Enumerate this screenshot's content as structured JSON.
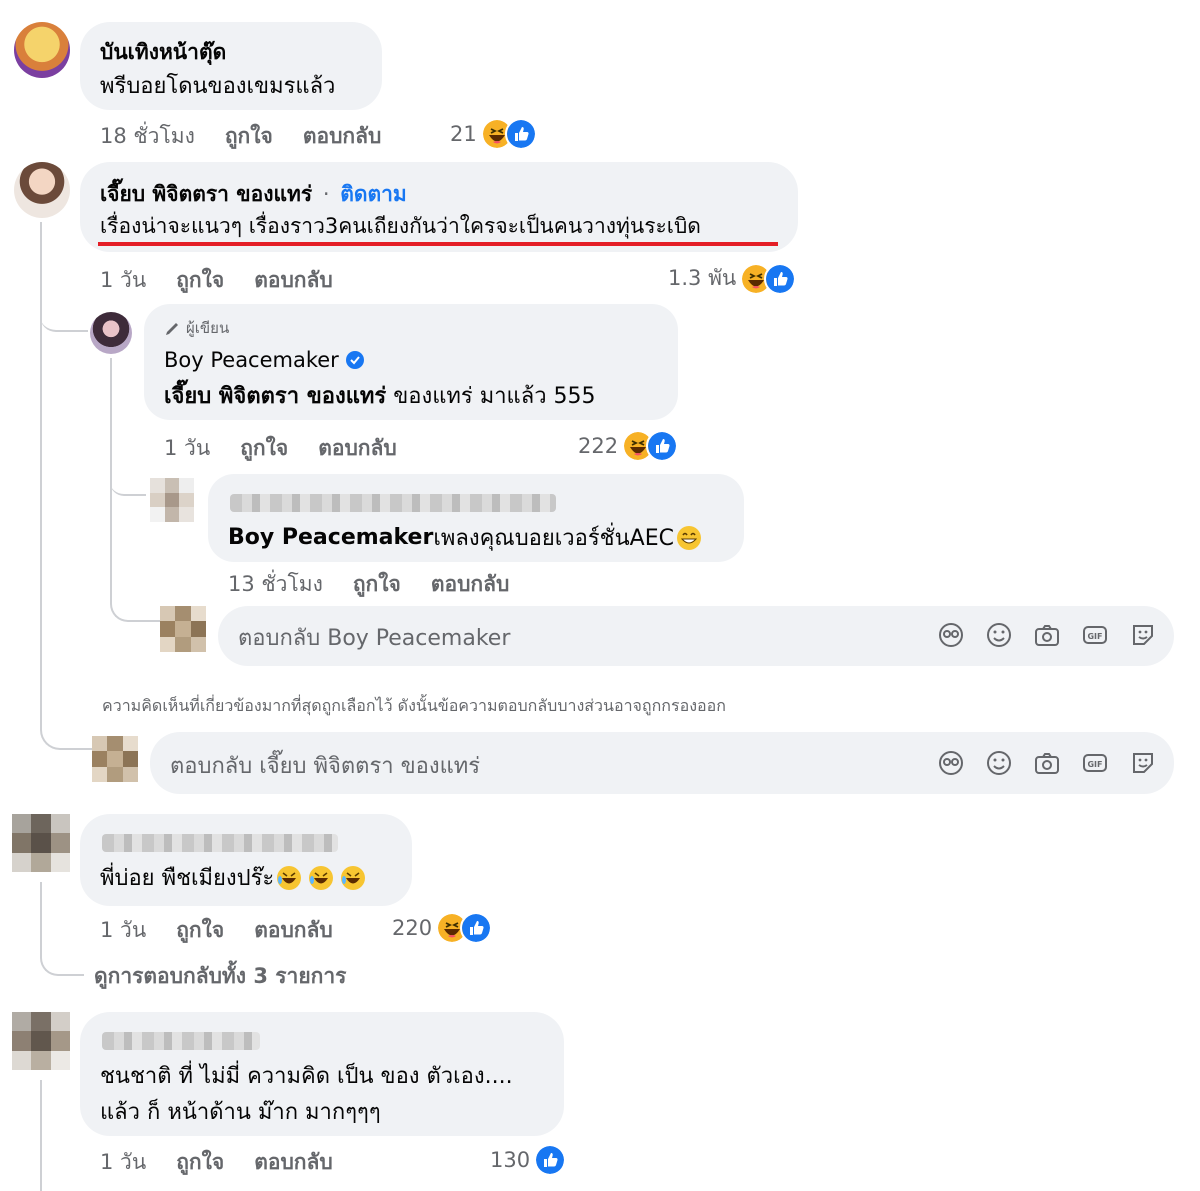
{
  "comments": [
    {
      "author": "บันเทิงหน้าตุ๊ด",
      "text": "พรีบอยโดนของเขมรแล้ว",
      "time": "18 ชั่วโมง",
      "like": "ถูกใจ",
      "reply": "ตอบกลับ",
      "reaction_count": "21"
    },
    {
      "author": "เจี๊ยบ พิจิตตรา ของแทร่",
      "separator": "·",
      "follow": "ติดตาม",
      "text": "เรื่องน่าจะแนวๆ เรื่องราว3คนเถียงกันว่าใครจะเป็นคนวางทุ่นระเบิด",
      "time": "1 วัน",
      "like": "ถูกใจ",
      "reply": "ตอบกลับ",
      "reaction_count": "1.3 พัน",
      "replies": [
        {
          "badge": "ผู้เขียน",
          "author": "Boy Peacemaker",
          "mention": "เจี๊ยบ พิจิตตรา ของแทร่",
          "text": " ของแทร่ มาแล้ว 555",
          "time": "1 วัน",
          "like": "ถูกใจ",
          "reply": "ตอบกลับ",
          "reaction_count": "222"
        },
        {
          "mention": "Boy Peacemaker",
          "text": " เพลงคุณบอยเวอร์ชั่นAEC",
          "time": "13 ชั่วโมง",
          "like": "ถูกใจ",
          "reply": "ตอบกลับ"
        }
      ],
      "reply_box_placeholder": "ตอบกลับ Boy Peacemaker",
      "filter_notice": "ความคิดเห็นที่เกี่ยวข้องมากที่สุดถูกเลือกไว้ ดังนั้นข้อความตอบกลับบางส่วนอาจถูกกรองออก",
      "main_reply_placeholder": "ตอบกลับ เจี๊ยบ พิจิตตรา ของแทร่"
    },
    {
      "text": "พี่บ่อย พืชเมียงปร๊ะ",
      "time": "1 วัน",
      "like": "ถูกใจ",
      "reply": "ตอบกลับ",
      "reaction_count": "220",
      "view_replies": "ดูการตอบกลับทั้ง 3 รายการ"
    },
    {
      "text_line1": "ชนชาติ ที่ ไม่มี่ ความคิด เป็น ของ ตัวเอง....",
      "text_line2": "แล้ว ก็ หน้าด้าน ม๊าก มากๆๆๆ",
      "time": "1 วัน",
      "like": "ถูกใจ",
      "reply": "ตอบกลับ",
      "reaction_count": "130"
    }
  ],
  "colors": {
    "bubble": "#f0f2f5",
    "secondary_text": "#65676b",
    "link": "#1877f2",
    "highlight_underline": "#e41e26",
    "haha": "#f7b125",
    "like": "#1877f2"
  },
  "icons": [
    "haha-reaction-icon",
    "like-reaction-icon",
    "pencil-icon",
    "verified-badge-icon",
    "avatar-sticker-icon",
    "emoji-icon",
    "camera-icon",
    "gif-icon",
    "sticker-icon",
    "grin-emoji",
    "rolling-laugh-emoji"
  ]
}
